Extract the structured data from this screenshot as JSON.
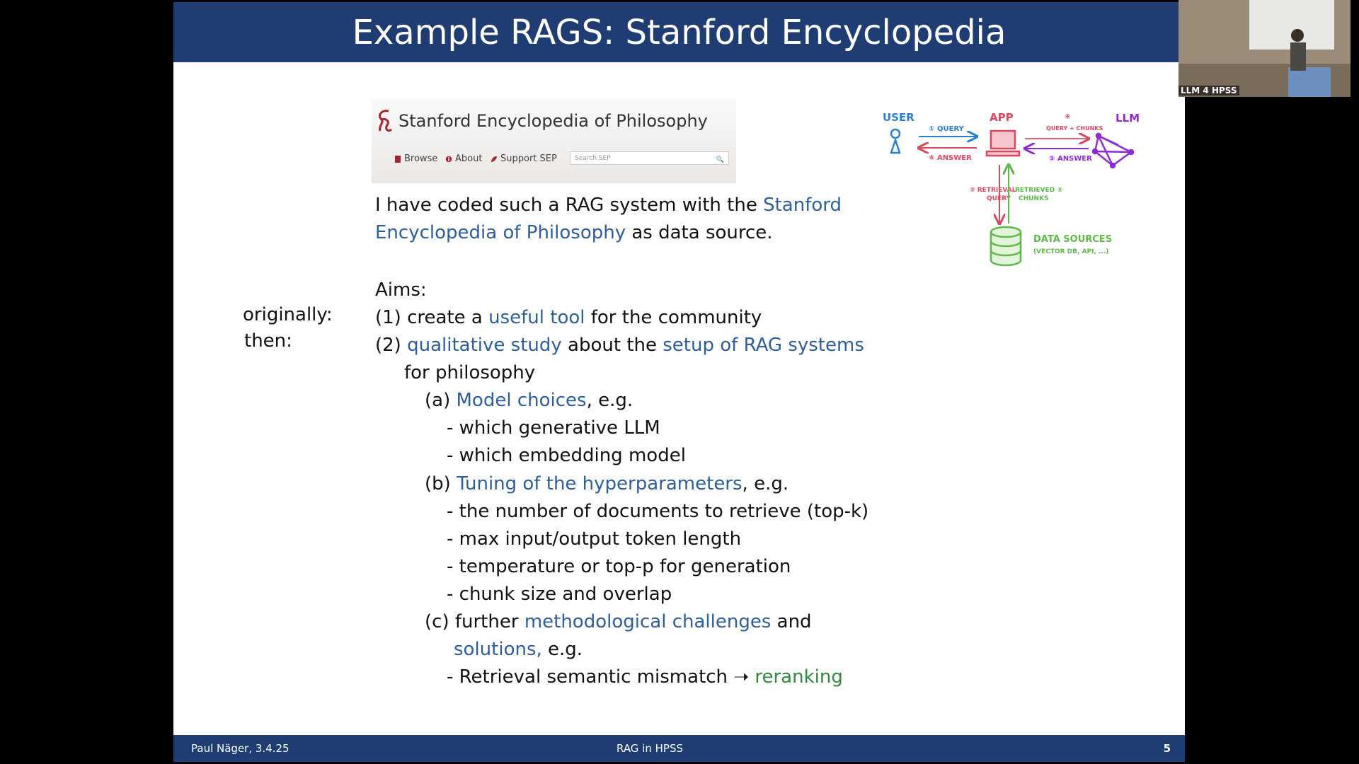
{
  "slide": {
    "title": "Example RAGS: Stanford Encyclopedia",
    "footer": {
      "author": "Paul Näger, 3.4.25",
      "title": "RAG in HPSS",
      "page": "5"
    }
  },
  "sep": {
    "name": "Stanford Encyclopedia of Philosophy",
    "nav": [
      "Browse",
      "About",
      "Support SEP"
    ],
    "search_placeholder": "Search SEP"
  },
  "intro": {
    "pre": "I have coded such a RAG system with the ",
    "link1": "Stanford",
    "link2": "Encyclopedia of Philosophy",
    "post": " as data source."
  },
  "aims": {
    "heading": "Aims:",
    "label_originally": "originally:",
    "label_then": "then:",
    "aim1": {
      "num": "(1)",
      "pre": " create a ",
      "hl": "useful tool",
      "post": " for the community"
    },
    "aim2": {
      "num": "(2)",
      "hl1": "qualitative study",
      "mid": " about the ",
      "hl2": "setup of RAG systems",
      "cont": "for philosophy"
    },
    "a": {
      "label": "(a)",
      "hl": "Model choices",
      "post": ", e.g.",
      "items": [
        "- which generative LLM",
        "- which embedding model"
      ]
    },
    "b": {
      "label": "(b)",
      "hl": "Tuning of the hyperparameters",
      "post": ", e.g.",
      "items": [
        "- the number of documents to retrieve (top-k)",
        "- max input/output token length",
        "- temperature or top-p for generation",
        "- chunk size and overlap"
      ]
    },
    "c": {
      "label": "(c)",
      "pre": " further ",
      "hl1": "methodological challenges",
      "mid": " and",
      "hl2": "solutions,",
      "post": " e.g.",
      "item_pre": "- Retrieval semantic mismatch ➝ ",
      "item_hl": "reranking"
    }
  },
  "diagram": {
    "user": "USER",
    "app": "APP",
    "llm": "LLM",
    "step1": "① QUERY",
    "step6": "⑥ ANSWER",
    "step4_num": "④",
    "step4": "QUERY + CHUNKS",
    "step5": "⑤ ANSWER",
    "step2a": "② RETRIEVAL",
    "step2b": "QUERY",
    "step3a": "RETRIEVED ③",
    "step3b": "CHUNKS",
    "ds": "DATA SOURCES",
    "ds_sub": "(VECTOR DB, API, ...)",
    "colors": {
      "blue": "#2b7fd0",
      "red": "#d9485f",
      "pink": "#e8607a",
      "purple": "#8e2bd6",
      "green": "#5fb84a"
    }
  },
  "camera": {
    "label": "LLM 4 HPSS"
  }
}
